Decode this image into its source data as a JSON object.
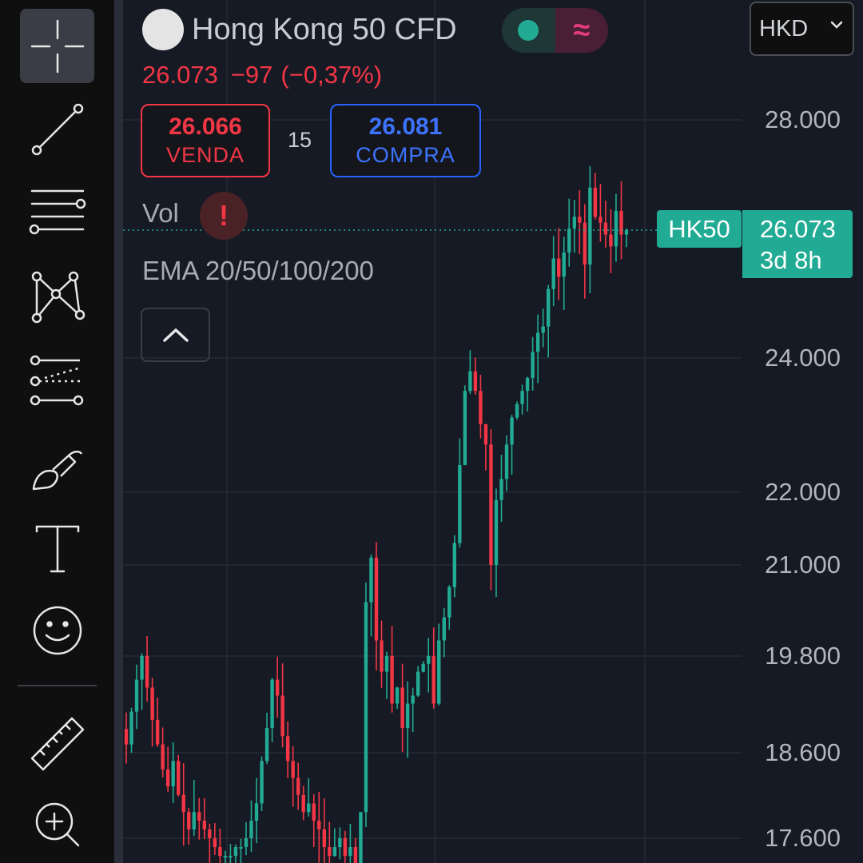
{
  "symbol": {
    "name": "Hong Kong 50 CFD",
    "last_price": "26.073",
    "change": "−97",
    "change_pct": "(−0,37%)"
  },
  "trade": {
    "sell_price": "26.066",
    "sell_label": "VENDA",
    "spread": "15",
    "buy_price": "26.081",
    "buy_label": "COMPRA"
  },
  "indicators": {
    "volume_label": "Vol",
    "alert_glyph": "!",
    "ema_label": "EMA 20/50/100/200"
  },
  "status": {
    "market_open_color": "#22ab94",
    "wave_glyph": "≈"
  },
  "currency": {
    "selected": "HKD"
  },
  "price_tag": {
    "symbol": "HK50",
    "price": "26.073",
    "countdown": "3d 8h"
  },
  "toolbar": {
    "icons": [
      "crosshair-icon",
      "trend-line-icon",
      "horizontal-lines-icon",
      "pattern-icon",
      "forecast-icon",
      "brush-icon",
      "text-icon",
      "emoji-icon",
      "ruler-icon",
      "zoom-in-icon"
    ]
  },
  "colors": {
    "up": "#22ab94",
    "down": "#f23645",
    "background": "#161a25",
    "grid": "#262a34"
  },
  "chart_data": {
    "type": "candlestick",
    "y_axis_labels": [
      "28.000",
      "24.000",
      "22.000",
      "21.000",
      "19.800",
      "18.600",
      "17.600"
    ],
    "y_axis_scale": "log",
    "grid": true,
    "last_price": 26073,
    "close_series": [
      18700,
      19100,
      19500,
      19800,
      19400,
      19000,
      18700,
      18400,
      18200,
      18500,
      18100,
      17900,
      17700,
      17900,
      17800,
      17700,
      17600,
      17500,
      17400,
      17400,
      17400,
      17500,
      17500,
      17600,
      17800,
      18000,
      18500,
      18900,
      19500,
      19300,
      18800,
      18500,
      18300,
      18100,
      17900,
      18000,
      17800,
      17700,
      17500,
      17400,
      17500,
      17600,
      17400,
      17500,
      17300,
      17900,
      20500,
      21100,
      20000,
      19600,
      19800,
      19200,
      19400,
      18900,
      19200,
      19300,
      19600,
      19700,
      19800,
      19200,
      20000,
      20300,
      20700,
      21300,
      22400,
      23500,
      23800,
      23500,
      23000,
      22700,
      21000,
      21900,
      22200,
      22700,
      23100,
      23300,
      23500,
      23700,
      24100,
      24400,
      24500,
      25100,
      25600,
      25300,
      25700,
      26100,
      26300,
      26200,
      25500,
      26800,
      26300,
      26200,
      26000,
      25800,
      26400,
      26000,
      26073
    ]
  }
}
